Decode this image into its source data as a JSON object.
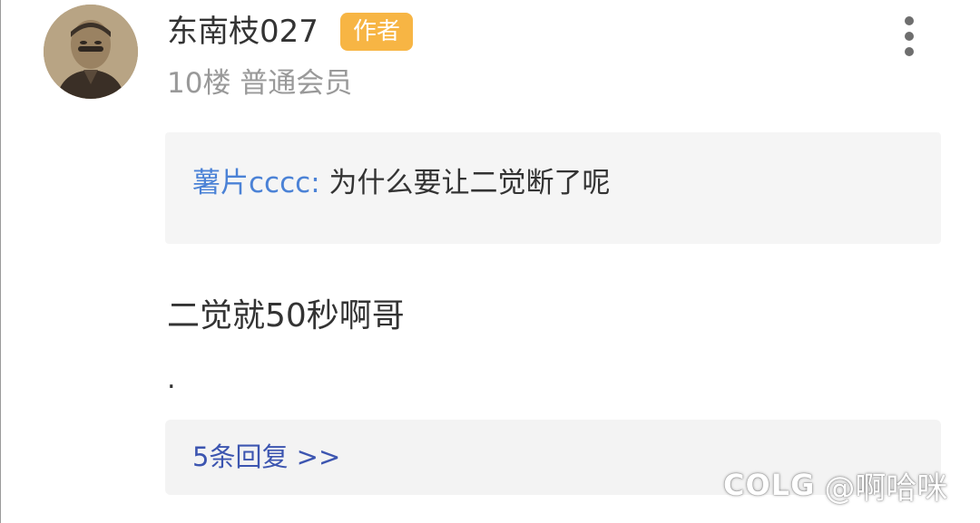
{
  "post": {
    "username": "东南枝027",
    "author_badge": "作者",
    "floor_info": "10楼 普通会员",
    "quote": {
      "user": "薯片cccc",
      "separator": ":",
      "text": "为什么要让二觉断了呢"
    },
    "content": "二觉就50秒啊哥",
    "content_extra": ".",
    "replies_link": "5条回复 >>"
  },
  "watermark": {
    "logo": "COLG",
    "handle": "@啊哈咪"
  },
  "icons": {
    "more": "more-vertical-icon",
    "avatar": "user-avatar"
  },
  "colors": {
    "badge_bg": "#f7b544",
    "quote_user": "#4b82d6",
    "reply_link": "#3c55b0",
    "panel_bg": "#f5f5f5"
  }
}
